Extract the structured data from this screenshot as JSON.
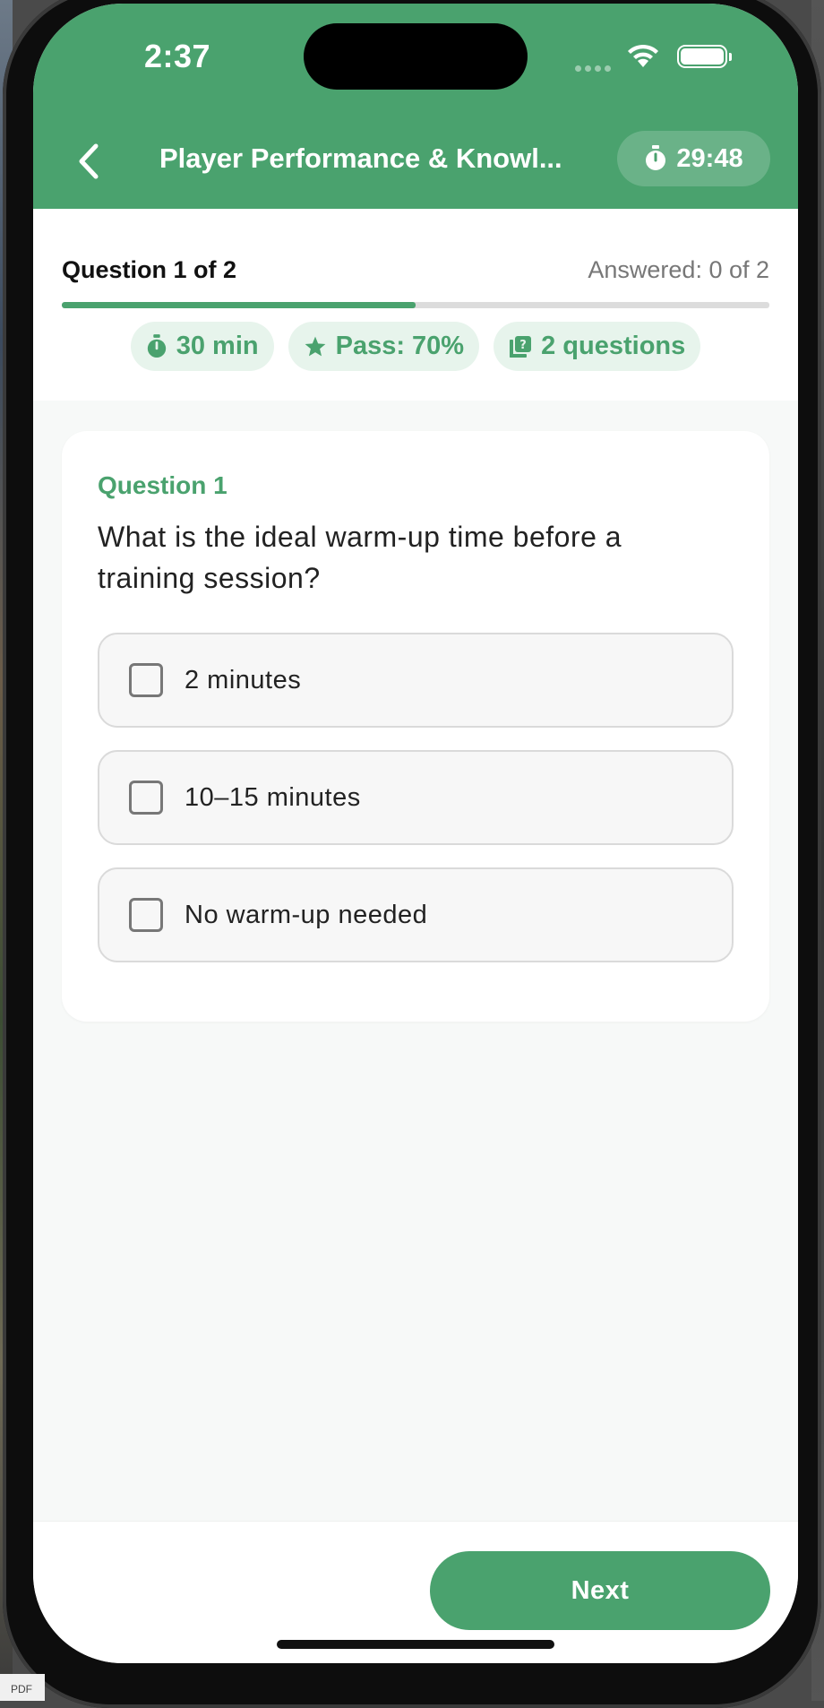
{
  "status_bar": {
    "time": "2:37"
  },
  "header": {
    "title": "Player Performance & Knowl...",
    "timer": "29:48"
  },
  "progress": {
    "question_count": "Question 1 of 2",
    "answered": "Answered: 0 of 2",
    "fraction": 0.5
  },
  "chips": [
    {
      "icon": "stopwatch-icon",
      "label": "30 min"
    },
    {
      "icon": "star-icon",
      "label": "Pass: 70%"
    },
    {
      "icon": "question-book-icon",
      "label": "2 questions"
    }
  ],
  "question": {
    "label": "Question 1",
    "text": "What is the ideal warm-up time before a training session?",
    "options": [
      {
        "label": "2 minutes",
        "checked": false
      },
      {
        "label": "10–15 minutes",
        "checked": false
      },
      {
        "label": "No warm-up needed",
        "checked": false
      }
    ]
  },
  "footer": {
    "next_label": "Next"
  },
  "colors": {
    "accent": "#4aa26e",
    "chip_bg": "#e7f4ec"
  }
}
